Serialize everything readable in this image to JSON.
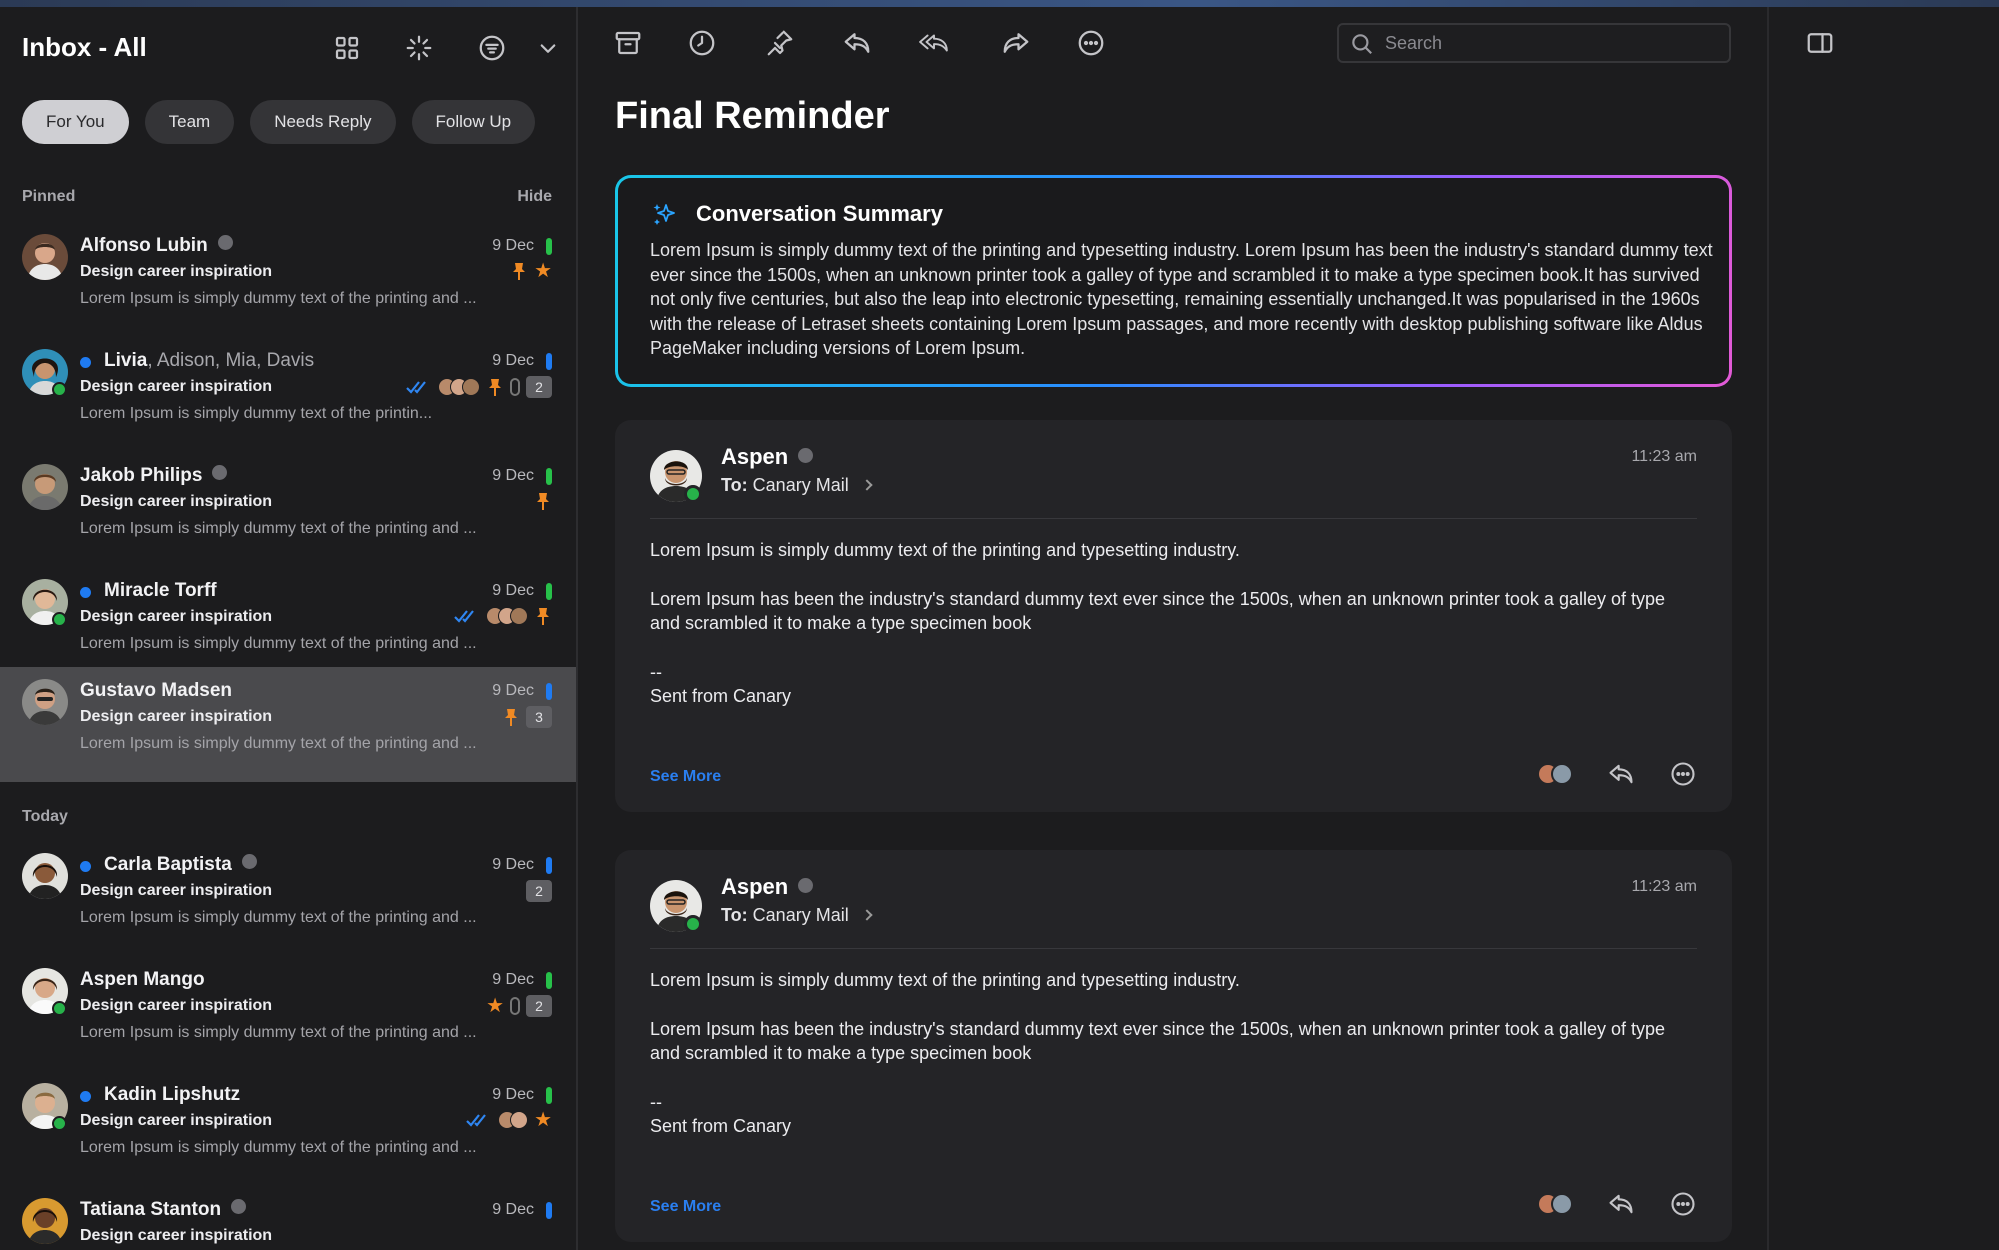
{
  "sidebar": {
    "title": "Inbox - All",
    "filters": [
      "For You",
      "Team",
      "Needs Reply",
      "Follow Up"
    ],
    "pinned_label": "Pinned",
    "hide_label": "Hide",
    "today_label": "Today",
    "pinned": [
      {
        "sender": "Alfonso Lubin",
        "others": "",
        "date": "9 Dec",
        "subject": "Design career inspiration",
        "preview": "Lorem Ipsum is simply dummy text of the printing and ...",
        "bar_color": "#27c14a"
      },
      {
        "sender": "Livia",
        "others": ", Adison, Mia, Davis",
        "date": "9 Dec",
        "subject": "Design career inspiration",
        "preview": "Lorem Ipsum is simply dummy text of the printin...",
        "count": "2",
        "bar_color": "#1f7bf2"
      },
      {
        "sender": "Jakob Philips",
        "others": "",
        "date": "9 Dec",
        "subject": "Design career inspiration",
        "preview": "Lorem Ipsum is simply dummy text of the printing and ...",
        "bar_color": "#27c14a"
      },
      {
        "sender": "Miracle Torff",
        "others": "",
        "date": "9 Dec",
        "subject": "Design career inspiration",
        "preview": "Lorem Ipsum is simply dummy text of the printing and ...",
        "bar_color": "#27c14a"
      },
      {
        "sender": "Gustavo Madsen",
        "others": "",
        "date": "9 Dec",
        "subject": "Design career inspiration",
        "preview": "Lorem Ipsum is simply dummy text of the printing and ...",
        "count": "3",
        "bar_color": "#1f7bf2"
      }
    ],
    "today": [
      {
        "sender": "Carla Baptista",
        "date": "9 Dec",
        "subject": "Design career inspiration",
        "preview": "Lorem Ipsum is simply dummy text of the printing and ...",
        "count": "2",
        "bar_color": "#1f7bf2"
      },
      {
        "sender": "Aspen Mango",
        "date": "9 Dec",
        "subject": "Design career inspiration",
        "preview": "Lorem Ipsum is simply dummy text of the printing and ...",
        "count": "2",
        "bar_color": "#27c14a"
      },
      {
        "sender": "Kadin Lipshutz",
        "date": "9 Dec",
        "subject": "Design career inspiration",
        "preview": "Lorem Ipsum is simply dummy text of the printing and ...",
        "bar_color": "#27c14a"
      },
      {
        "sender": "Tatiana Stanton",
        "date": "9 Dec",
        "subject": "Design career inspiration",
        "bar_color": "#1f7bf2"
      }
    ]
  },
  "toolbar": {
    "icons": [
      "archive-icon",
      "snooze-clock-icon",
      "pin-icon",
      "reply-icon",
      "reply-all-icon",
      "forward-icon",
      "more-icon"
    ],
    "search_placeholder": "Search"
  },
  "thread": {
    "title": "Final Reminder",
    "summary": {
      "title": "Conversation Summary",
      "text": "Lorem Ipsum is simply dummy text of the printing and typesetting industry. Lorem Ipsum has been the industry's standard dummy text ever since the 1500s, when an unknown printer took a galley of type and scrambled it to make a type specimen book.It has survived not only five centuries, but also the leap into electronic typesetting, remaining essentially unchanged.It was popularised in the 1960s with the release of Letraset sheets containing Lorem Ipsum passages, and more recently with desktop publishing software like Aldus PageMaker including versions of Lorem Ipsum."
    },
    "messages": [
      {
        "sender": "Aspen",
        "to_label": "To:",
        "to": "Canary Mail",
        "time": "11:23 am",
        "p1": "Lorem Ipsum is simply dummy text of the printing and typesetting industry.",
        "p2": "Lorem Ipsum has been the industry's standard dummy text ever since the 1500s, when an unknown printer took a galley of type and scrambled it to make a type specimen book",
        "sig_dash": "--",
        "sig": "Sent from Canary",
        "see_more": "See More"
      },
      {
        "sender": "Aspen",
        "to_label": "To:",
        "to": "Canary Mail",
        "time": "11:23 am",
        "p1": "Lorem Ipsum is simply dummy text of the printing and typesetting industry.",
        "p2": "Lorem Ipsum has been the industry's standard dummy text ever since the 1500s, when an unknown printer took a galley of type and scrambled it to make a type specimen book",
        "sig_dash": "--",
        "sig": "Sent from Canary",
        "see_more": "See More"
      }
    ]
  },
  "colors": {
    "accent": "#1f7bf2",
    "online": "#27b24a",
    "pin": "#f08a24",
    "unread_green": "#27c14a"
  }
}
